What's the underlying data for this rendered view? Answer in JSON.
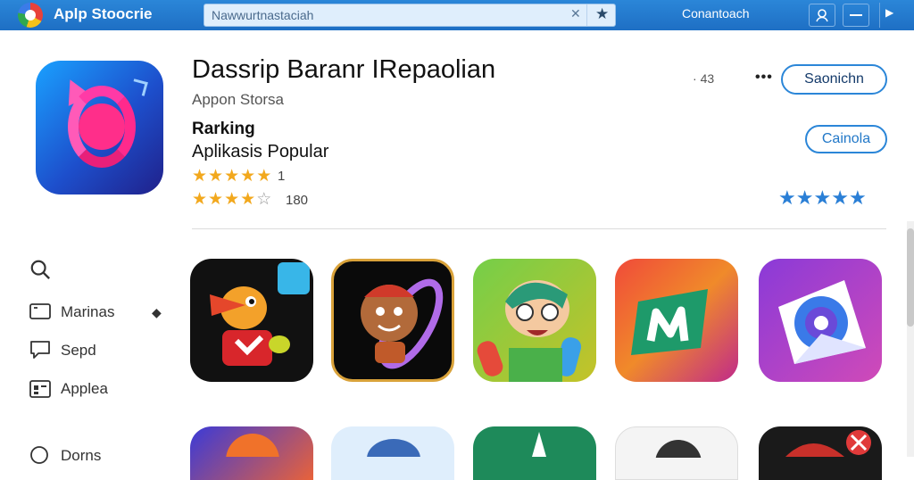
{
  "header": {
    "app_title": "Aplp Stoocrie",
    "search": {
      "value": "Nawwurtnastaciah"
    },
    "connect_label": "Conantoach",
    "icons": [
      "app-logo",
      "search-clear-icon",
      "star-icon",
      "account-icon",
      "menu-icon",
      "chevron-right-icon"
    ]
  },
  "app": {
    "name": "Dassrip Baranr IRepaolian",
    "publisher": "Appon Storsa",
    "ranking_label": "Rarking",
    "category": "Aplikasis Popular",
    "rating1": {
      "filled": 5,
      "count": "1"
    },
    "rating2": {
      "filled": 4,
      "count": "180"
    },
    "size_text": "43",
    "primary_button": "Saonichn",
    "secondary_button": "Cainola",
    "blue_stars": 5
  },
  "sidebar": {
    "items": [
      {
        "label": "",
        "icon": "search-icon"
      },
      {
        "label": "Marinas",
        "icon": "folder-icon"
      },
      {
        "label": "Sepd",
        "icon": "chat-icon"
      },
      {
        "label": "Applea",
        "icon": "apps-icon"
      },
      {
        "label": "Dorns",
        "icon": "clock-icon"
      }
    ]
  },
  "grid": {
    "row1": [
      "cartoon-bird-app-icon",
      "smiling-face-app-icon",
      "kid-character-app-icon",
      "video-m-app-icon",
      "mail-swirl-app-icon"
    ],
    "row2": [
      "game-app-icon",
      "avatar-app-icon",
      "green-app-icon",
      "dark-app-icon",
      "red-x-app-icon"
    ]
  },
  "colors": {
    "accent": "#2b86d8",
    "star": "#f2a81d",
    "blue_star": "#2a7fd6"
  }
}
